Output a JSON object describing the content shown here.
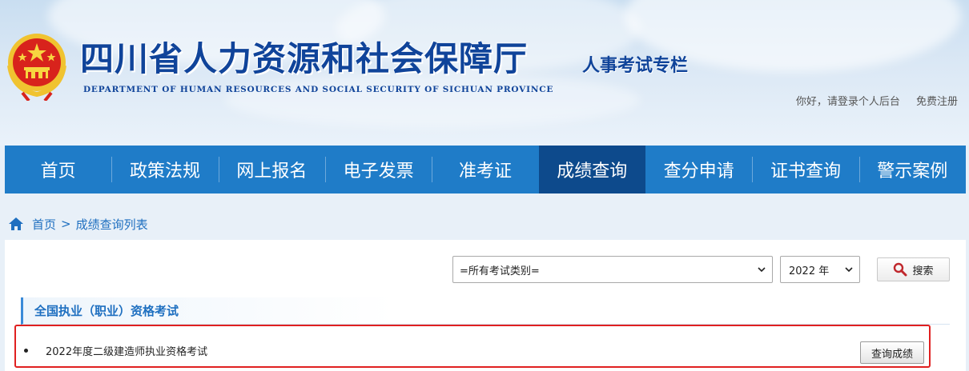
{
  "header": {
    "title_cn": "四川省人力资源和社会保障厅",
    "title_en": "DEPARTMENT OF HUMAN RESOURCES AND SOCIAL SECURITY OF SICHUAN PROVINCE",
    "subtitle": "人事考试专栏",
    "emblem_icon": "national-emblem-icon",
    "user_links": {
      "login": "你好，请登录个人后台",
      "register": "免费注册"
    }
  },
  "nav": {
    "items": [
      {
        "label": "首页"
      },
      {
        "label": "政策法规"
      },
      {
        "label": "网上报名"
      },
      {
        "label": "电子发票"
      },
      {
        "label": "准考证"
      },
      {
        "label": "成绩查询",
        "active": true
      },
      {
        "label": "查分申请"
      },
      {
        "label": "证书查询"
      },
      {
        "label": "警示案例"
      }
    ]
  },
  "breadcrumb": {
    "home_icon": "home-icon",
    "home": "首页",
    "separator": ">",
    "current": "成绩查询列表"
  },
  "filters": {
    "exam_type_selected": "=所有考试类别=",
    "year_selected": "2022 年",
    "search_label": "搜索",
    "search_icon": "magnifier-icon"
  },
  "section": {
    "title": "全国执业（职业）资格考试",
    "items": [
      {
        "name": "2022年度二级建造师执业资格考试",
        "button": "查询成绩"
      }
    ]
  },
  "colors": {
    "nav_bg": "#1f7cc8",
    "nav_active": "#0d4a8c",
    "title_blue": "#10449a",
    "highlight_red": "#e02020"
  }
}
